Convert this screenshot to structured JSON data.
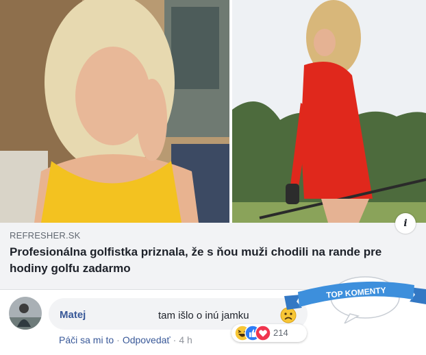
{
  "link_preview": {
    "domain": "REFRESHER.SK",
    "title": "Profesionálna golfistka priznala, že s ňou muži chodili na rande pre hodiny golfu zadarmo",
    "info_icon": "i"
  },
  "comment": {
    "author": "Matej",
    "text": "tam išlo o inú jamku",
    "like_label": "Páči sa mi to",
    "reply_label": "Odpovedať",
    "time": "4 h",
    "reaction_count": "214",
    "reactions": [
      "haha-icon",
      "like-icon",
      "love-icon"
    ]
  },
  "badge": {
    "label": "TOP KOMENTY"
  },
  "colors": {
    "link_blue": "#385898",
    "badge_blue": "#3d8fdc",
    "card_bg": "#f2f3f5"
  }
}
